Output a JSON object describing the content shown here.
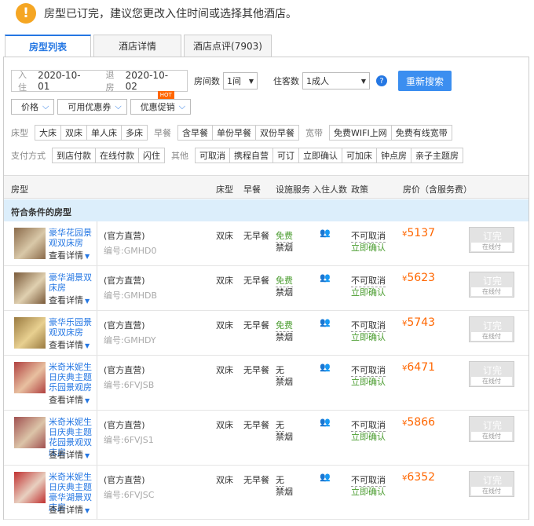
{
  "notice": "房型已订完，建议您更改入住时间或选择其他酒店。",
  "tabs": [
    "房型列表",
    "酒店详情",
    "酒店点评(7903)"
  ],
  "search": {
    "checkin_label": "入住",
    "checkin": "2020-10-01",
    "checkout_label": "退房",
    "checkout": "2020-10-02",
    "rooms_label": "房间数",
    "rooms": "1间",
    "guests_label": "住客数",
    "guests": "1成人",
    "button": "重新搜索"
  },
  "dropdowns": [
    "价格",
    "可用优惠券",
    "优惠促销"
  ],
  "hot_badge": "HOT",
  "filters": {
    "bed_label": "床型",
    "bed": [
      "大床",
      "双床",
      "单人床",
      "多床"
    ],
    "breakfast_label": "早餐",
    "breakfast": [
      "含早餐",
      "单份早餐",
      "双份早餐"
    ],
    "broadband_label": "宽带",
    "broadband": [
      "免费WIFI上网",
      "免费有线宽带"
    ],
    "payment_label": "支付方式",
    "payment": [
      "到店付款",
      "在线付款",
      "闪住"
    ],
    "other_label": "其他",
    "other": [
      "可取消",
      "携程自营",
      "可订",
      "立即确认",
      "可加床",
      "钟点房",
      "亲子主题房"
    ]
  },
  "table_headers": [
    "房型",
    "床型",
    "早餐",
    "设施服务",
    "入住人数",
    "政策",
    "房价（含服务费）"
  ],
  "qualifying": "符合条件的房型",
  "detail_link": "查看详情",
  "rooms": [
    {
      "name": "豪华花园景观双床房",
      "vendor": "(官方直营)",
      "code": "编号:GMHD0",
      "bed": "双床",
      "breakfast": "无早餐",
      "wifi": "免费",
      "smoke": "禁烟",
      "persons": "👥",
      "cancel": "不可取消",
      "confirm": "立即确认",
      "price": "5137",
      "book": "订完",
      "pay": "在线付"
    },
    {
      "name": "豪华湖景双床房",
      "vendor": "(官方直营)",
      "code": "编号:GMHDB",
      "bed": "双床",
      "breakfast": "无早餐",
      "wifi": "免费",
      "smoke": "禁烟",
      "persons": "👥",
      "cancel": "不可取消",
      "confirm": "立即确认",
      "price": "5623",
      "book": "订完",
      "pay": "在线付"
    },
    {
      "name": "豪华乐园景观双床房",
      "vendor": "(官方直营)",
      "code": "编号:GMHDY",
      "bed": "双床",
      "breakfast": "无早餐",
      "wifi": "免费",
      "smoke": "禁烟",
      "persons": "👥",
      "cancel": "不可取消",
      "confirm": "立即确认",
      "price": "5743",
      "book": "订完",
      "pay": "在线付"
    },
    {
      "name": "米奇米妮生日庆典主题乐园景观房",
      "vendor": "(官方直营)",
      "code": "编号:6FVJSB",
      "bed": "双床",
      "breakfast": "无早餐",
      "wifi": "无",
      "smoke": "禁烟",
      "persons": "👥",
      "cancel": "不可取消",
      "confirm": "立即确认",
      "price": "6471",
      "book": "订完",
      "pay": "在线付"
    },
    {
      "name": "米奇米妮生日庆典主题花园景观双床房",
      "vendor": "(官方直营)",
      "code": "编号:6FVJS1",
      "bed": "双床",
      "breakfast": "无早餐",
      "wifi": "无",
      "smoke": "禁烟",
      "persons": "👥",
      "cancel": "不可取消",
      "confirm": "立即确认",
      "price": "5866",
      "book": "订完",
      "pay": "在线付"
    },
    {
      "name": "米奇米妮生日庆典主题豪华湖景双床房",
      "vendor": "(官方直营)",
      "code": "编号:6FVJSC",
      "bed": "双床",
      "breakfast": "无早餐",
      "wifi": "无",
      "smoke": "禁烟",
      "persons": "👥",
      "cancel": "不可取消",
      "confirm": "立即确认",
      "price": "6352",
      "book": "订完",
      "pay": "在线付"
    }
  ],
  "colors": {
    "accent": "#2577e3",
    "price": "#ff6600",
    "green": "#4a9c2f",
    "warning": "#f5a623"
  }
}
